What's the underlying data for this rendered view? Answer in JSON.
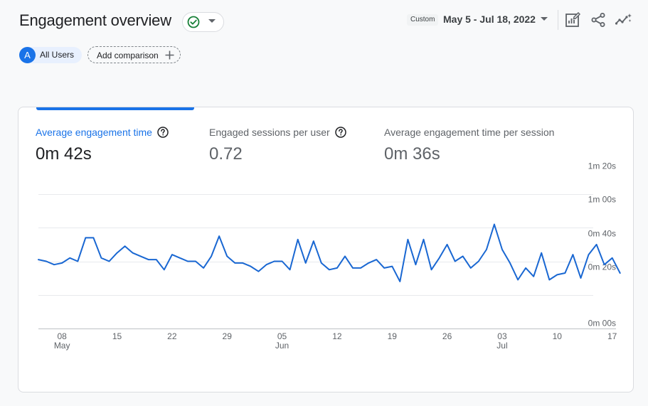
{
  "header": {
    "title": "Engagement overview",
    "custom_label": "Custom",
    "date_range": "May 5 - Jul 18, 2022",
    "icons": [
      "edit-report-icon",
      "share-icon",
      "insights-icon"
    ]
  },
  "filters": {
    "audience_avatar": "A",
    "audience": "All Users",
    "add_comparison": "Add comparison"
  },
  "metrics": [
    {
      "label": "Average engagement time",
      "value": "0m 42s",
      "active": true,
      "help": true
    },
    {
      "label": "Engaged sessions per user",
      "value": "0.72",
      "active": false,
      "help": true
    },
    {
      "label": "Average engagement time per session",
      "value": "0m 36s",
      "active": false,
      "help": false
    }
  ],
  "colors": {
    "accent": "#1a73e8",
    "success": "#188038",
    "line": "#1967d2"
  },
  "chart_data": {
    "type": "line",
    "series_name": "Average engagement time",
    "y_unit": "seconds",
    "ylim": [
      0,
      80
    ],
    "y_ticks": [
      {
        "value": 0,
        "label": "0m 00s"
      },
      {
        "value": 20,
        "label": "0m 20s"
      },
      {
        "value": 40,
        "label": "0m 40s"
      },
      {
        "value": 60,
        "label": "1m 00s"
      },
      {
        "value": 80,
        "label": "1m 20s"
      }
    ],
    "x_ticks": [
      {
        "index": 3,
        "label": "08",
        "sub": "May"
      },
      {
        "index": 10,
        "label": "15",
        "sub": ""
      },
      {
        "index": 17,
        "label": "22",
        "sub": ""
      },
      {
        "index": 24,
        "label": "29",
        "sub": ""
      },
      {
        "index": 31,
        "label": "05",
        "sub": "Jun"
      },
      {
        "index": 38,
        "label": "12",
        "sub": ""
      },
      {
        "index": 45,
        "label": "19",
        "sub": ""
      },
      {
        "index": 52,
        "label": "26",
        "sub": ""
      },
      {
        "index": 59,
        "label": "03",
        "sub": "Jul"
      },
      {
        "index": 66,
        "label": "10",
        "sub": ""
      },
      {
        "index": 73,
        "label": "17",
        "sub": ""
      }
    ],
    "grid": true,
    "start_date": "2022-05-05",
    "values": [
      41,
      40,
      38,
      39,
      42,
      40,
      54,
      54,
      42,
      40,
      45,
      49,
      45,
      43,
      41,
      41,
      35,
      44,
      42,
      40,
      40,
      36,
      43,
      55,
      43,
      39,
      39,
      37,
      34,
      38,
      40,
      40,
      35,
      53,
      39,
      52,
      39,
      35,
      36,
      43,
      36,
      36,
      39,
      41,
      36,
      37,
      28,
      53,
      38,
      53,
      35,
      42,
      50,
      40,
      43,
      36,
      40,
      47,
      62,
      47,
      39,
      29,
      36,
      31,
      45,
      29,
      32,
      33,
      44,
      30,
      44,
      50,
      38,
      42,
      33
    ]
  }
}
